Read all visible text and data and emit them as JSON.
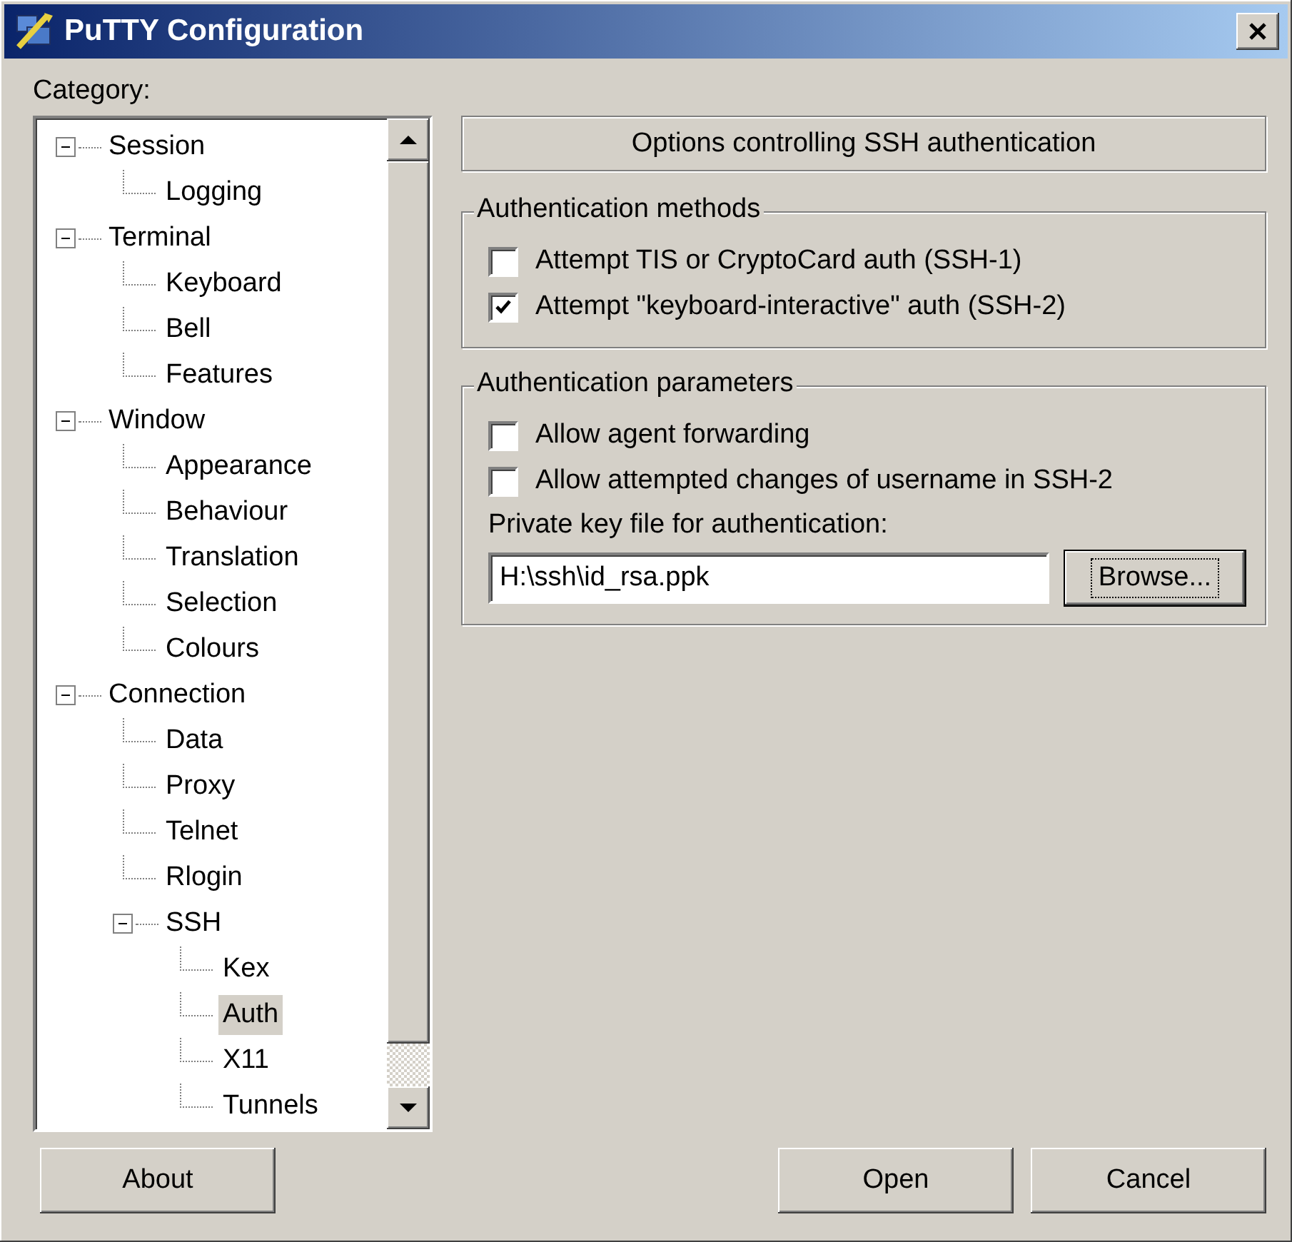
{
  "window": {
    "title": "PuTTY Configuration"
  },
  "category_label": "Category:",
  "tree": [
    {
      "label": "Session",
      "expanded": true,
      "selected": false,
      "children": [
        {
          "label": "Logging",
          "selected": false
        }
      ]
    },
    {
      "label": "Terminal",
      "expanded": true,
      "selected": false,
      "children": [
        {
          "label": "Keyboard",
          "selected": false
        },
        {
          "label": "Bell",
          "selected": false
        },
        {
          "label": "Features",
          "selected": false
        }
      ]
    },
    {
      "label": "Window",
      "expanded": true,
      "selected": false,
      "children": [
        {
          "label": "Appearance",
          "selected": false
        },
        {
          "label": "Behaviour",
          "selected": false
        },
        {
          "label": "Translation",
          "selected": false
        },
        {
          "label": "Selection",
          "selected": false
        },
        {
          "label": "Colours",
          "selected": false
        }
      ]
    },
    {
      "label": "Connection",
      "expanded": true,
      "selected": false,
      "children": [
        {
          "label": "Data",
          "selected": false
        },
        {
          "label": "Proxy",
          "selected": false
        },
        {
          "label": "Telnet",
          "selected": false
        },
        {
          "label": "Rlogin",
          "selected": false
        },
        {
          "label": "SSH",
          "expanded": true,
          "selected": false,
          "children": [
            {
              "label": "Kex",
              "selected": false
            },
            {
              "label": "Auth",
              "selected": true
            },
            {
              "label": "X11",
              "selected": false
            },
            {
              "label": "Tunnels",
              "selected": false
            }
          ]
        }
      ]
    }
  ],
  "panel": {
    "header": "Options controlling SSH authentication",
    "groups": [
      {
        "title": "Authentication methods",
        "items": [
          {
            "kind": "checkbox",
            "label": "Attempt TIS or CryptoCard auth (SSH-1)",
            "checked": false
          },
          {
            "kind": "checkbox",
            "label": "Attempt \"keyboard-interactive\" auth (SSH-2)",
            "checked": true
          }
        ]
      },
      {
        "title": "Authentication parameters",
        "items": [
          {
            "kind": "checkbox",
            "label": "Allow agent forwarding",
            "checked": false
          },
          {
            "kind": "checkbox",
            "label": "Allow attempted changes of username in SSH-2",
            "checked": false
          },
          {
            "kind": "file",
            "label": "Private key file for authentication:",
            "value": "H:\\ssh\\id_rsa.ppk",
            "button": "Browse...",
            "focused": true
          }
        ]
      }
    ]
  },
  "buttons": {
    "left": [
      "About"
    ],
    "right": [
      "Open",
      "Cancel"
    ]
  }
}
